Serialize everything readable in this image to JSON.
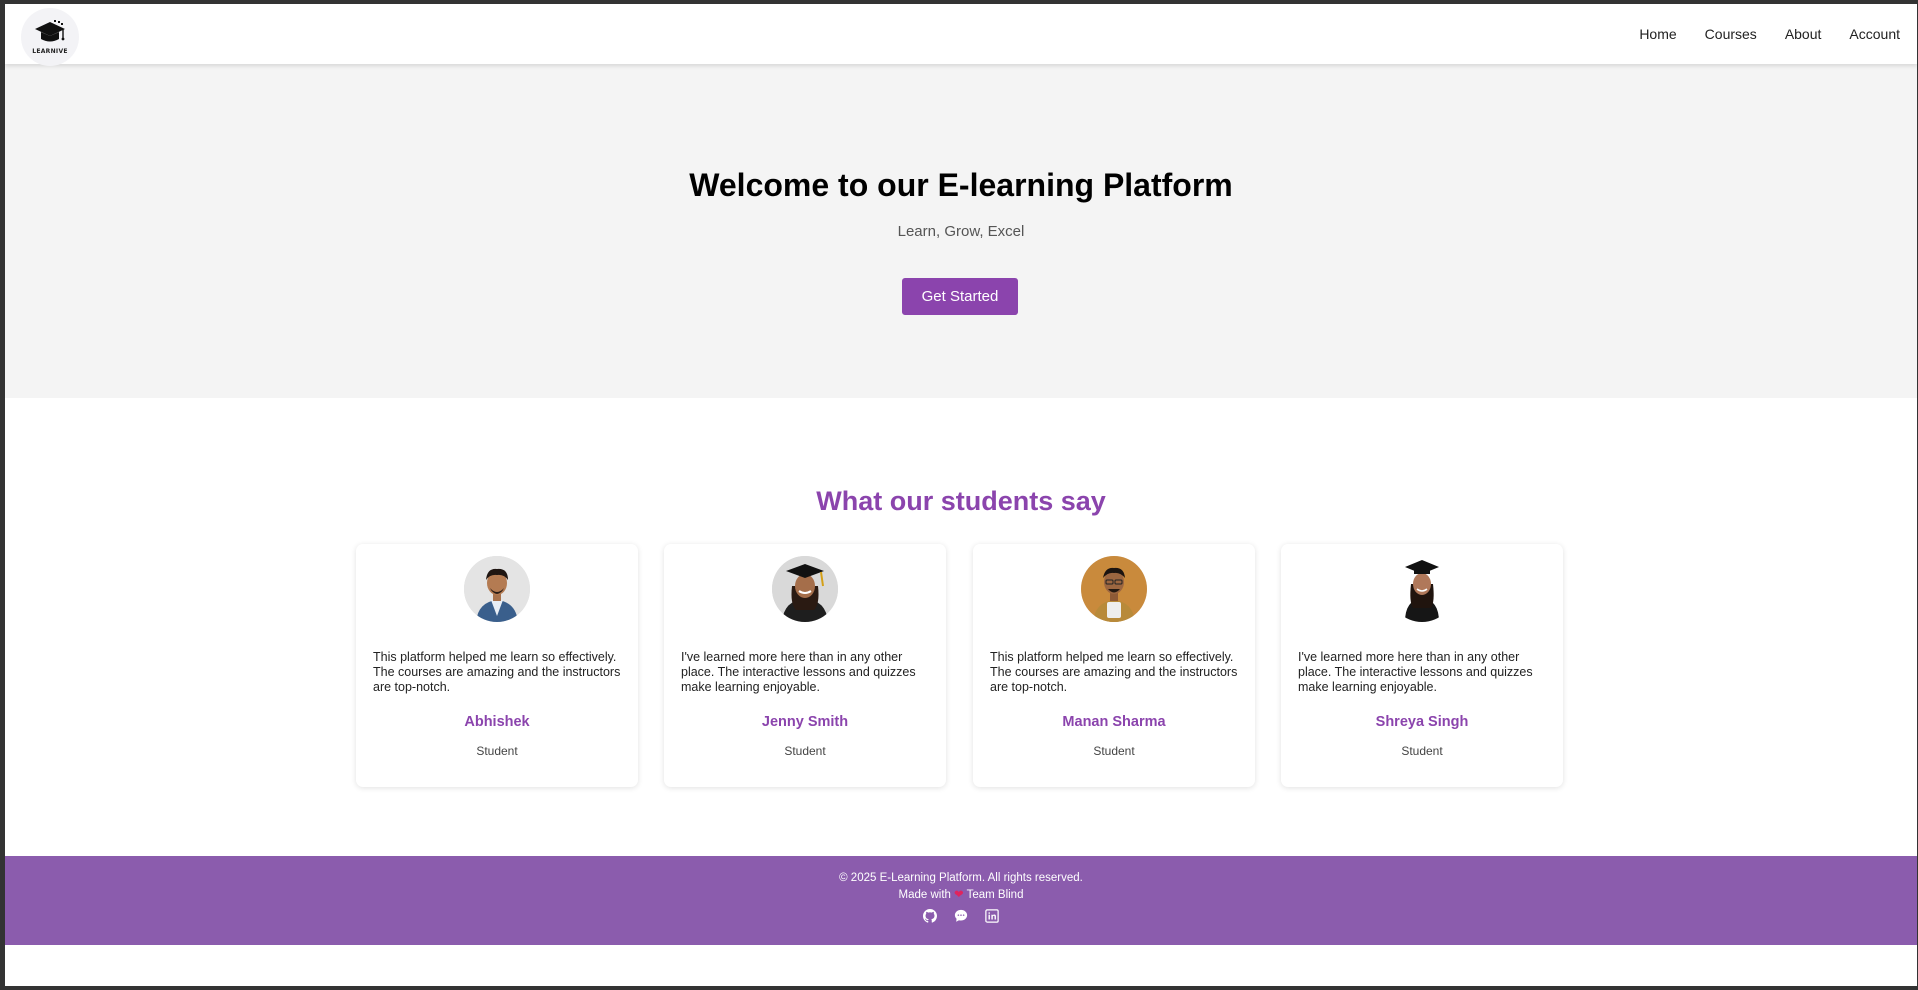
{
  "nav": {
    "logo_text": "LEARNIVE",
    "links": [
      "Home",
      "Courses",
      "About",
      "Account"
    ]
  },
  "hero": {
    "title": "Welcome to our E-learning Platform",
    "subtitle": "Learn, Grow, Excel",
    "cta_label": "Get Started"
  },
  "testimonials": {
    "title": "What our students say",
    "items": [
      {
        "quote": "This platform helped me learn so effectively. The courses are amazing and the instructors are top-notch.",
        "name": "Abhishek",
        "role": "Student"
      },
      {
        "quote": "I've learned more here than in any other place. The interactive lessons and quizzes make learning enjoyable.",
        "name": "Jenny Smith",
        "role": "Student"
      },
      {
        "quote": "This platform helped me learn so effectively. The courses are amazing and the instructors are top-notch.",
        "name": "Manan Sharma",
        "role": "Student"
      },
      {
        "quote": "I've learned more here than in any other place. The interactive lessons and quizzes make learning enjoyable.",
        "name": "Shreya Singh",
        "role": "Student"
      }
    ]
  },
  "footer": {
    "copyright": "© 2025 E-Learning Platform. All rights reserved.",
    "made_with": "Made with",
    "heart": "❤",
    "team": "Team Blind",
    "social_icons": [
      "github-icon",
      "chat-icon",
      "linkedin-icon"
    ]
  },
  "colors": {
    "accent": "#8b44ad",
    "footer_bg": "#8b5cad",
    "hero_bg": "#f4f4f4"
  }
}
